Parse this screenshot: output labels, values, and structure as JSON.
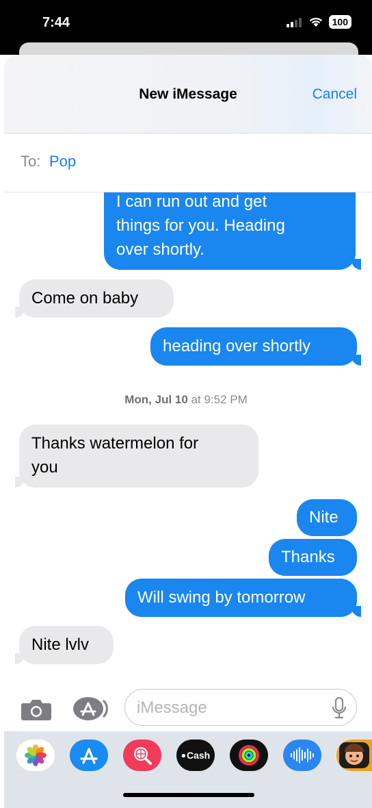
{
  "status": {
    "time": "7:44",
    "battery": "100"
  },
  "header": {
    "title": "New iMessage",
    "cancel_label": "Cancel"
  },
  "to": {
    "label": "To:",
    "recipient": "Pop"
  },
  "messages": {
    "m1": [
      "I can run out and get",
      "things for you. Heading",
      "over shortly."
    ],
    "m2": "Come on baby",
    "m3": "heading over shortly",
    "timestamp_day": "Mon, Jul 10",
    "timestamp_time": "at 9:52 PM",
    "m4": [
      "Thanks  watermelon for",
      "you"
    ],
    "m5": "Nite",
    "m6": "Thanks",
    "m7": "Will swing by tomorrow",
    "m8": "Nite lvlv"
  },
  "compose": {
    "placeholder": "iMessage"
  },
  "apps": {
    "cash_label": "Cash"
  },
  "colors": {
    "sent": "#1a86f0",
    "received": "#e9e9eb",
    "accent": "#1b7cf5"
  }
}
